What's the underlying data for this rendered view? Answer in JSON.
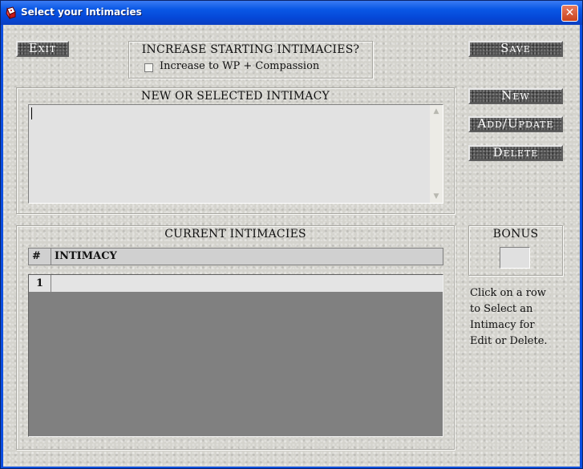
{
  "window": {
    "title": "Select your Intimacies",
    "icon": "app-dice-icon",
    "close_glyph": "✕"
  },
  "toolbar": {
    "exit_label": "Exit",
    "save_label": "Save",
    "new_label": "New",
    "add_update_label": "Add/Update",
    "delete_label": "Delete"
  },
  "increase_group": {
    "caption": "INCREASE STARTING INTIMACIES?",
    "checkbox_label": "Increase to WP + Compassion",
    "checked": false
  },
  "editor_group": {
    "caption": "NEW OR SELECTED INTIMACY",
    "value": ""
  },
  "current_group": {
    "caption": "CURRENT INTIMACIES",
    "columns": [
      "#",
      "INTIMACY"
    ],
    "rows": [
      {
        "num": "1",
        "intimacy": ""
      }
    ]
  },
  "bonus_group": {
    "caption": "BONUS",
    "value": ""
  },
  "help": {
    "lines": [
      "Click on a row",
      "to Select an",
      "Intimacy for",
      "Edit or Delete."
    ]
  },
  "colors": {
    "titlebar": "#0548d8",
    "button_stone": "#4e4e4e",
    "client_bg": "#d4d3cd",
    "grid_bg": "#808080"
  }
}
